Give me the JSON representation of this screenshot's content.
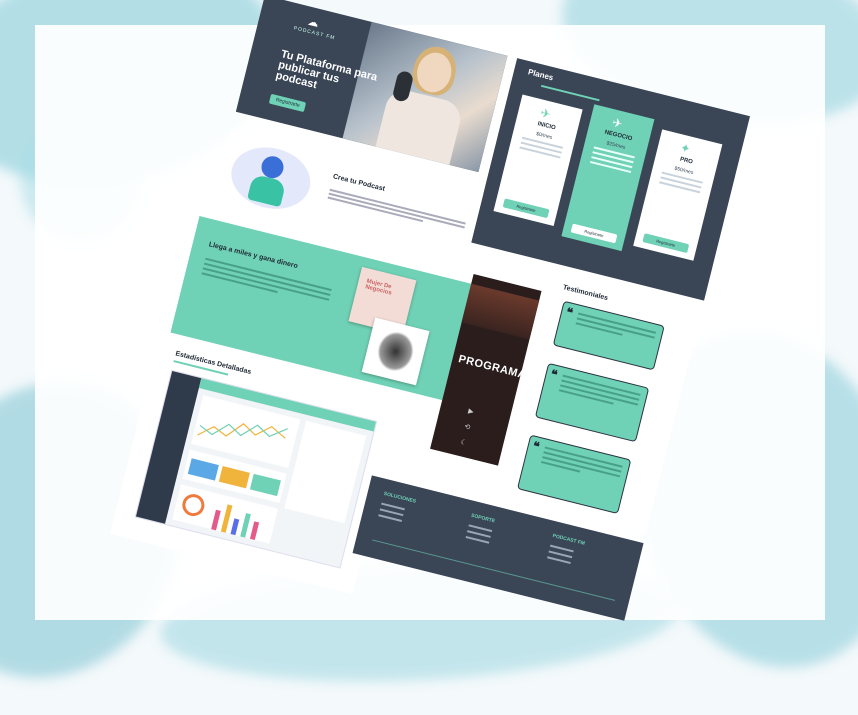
{
  "hero": {
    "brand": "PODCAST FM",
    "title": "Tu Plataforma para publicar tus podcast",
    "cta": "Registrarte"
  },
  "planes": {
    "heading": "Planes",
    "cards": [
      {
        "name": "INICIO",
        "price": "$0/mes",
        "button": "Registrarte"
      },
      {
        "name": "NEGOCIO",
        "price": "$25/mes",
        "button": "Registrarte"
      },
      {
        "name": "PRO",
        "price": "$50/mes",
        "button": "Registrarte"
      }
    ]
  },
  "crea": {
    "heading": "Crea tu Podcast"
  },
  "llega": {
    "heading": "Llega a miles y gana dinero",
    "cover_title": "Mujer De Negocios"
  },
  "app": {
    "title": "PROGRAMAR"
  },
  "testimonials": {
    "heading": "Testimoniales"
  },
  "stats": {
    "heading": "Estadísticas Detalladas"
  },
  "footer": {
    "columns": [
      "SOLUCIONES",
      "SOPORTE",
      "PODCAST FM"
    ]
  },
  "colors": {
    "accent": "#6fd1b5",
    "dark": "#3a4556",
    "wash": "#7fc9d6"
  }
}
